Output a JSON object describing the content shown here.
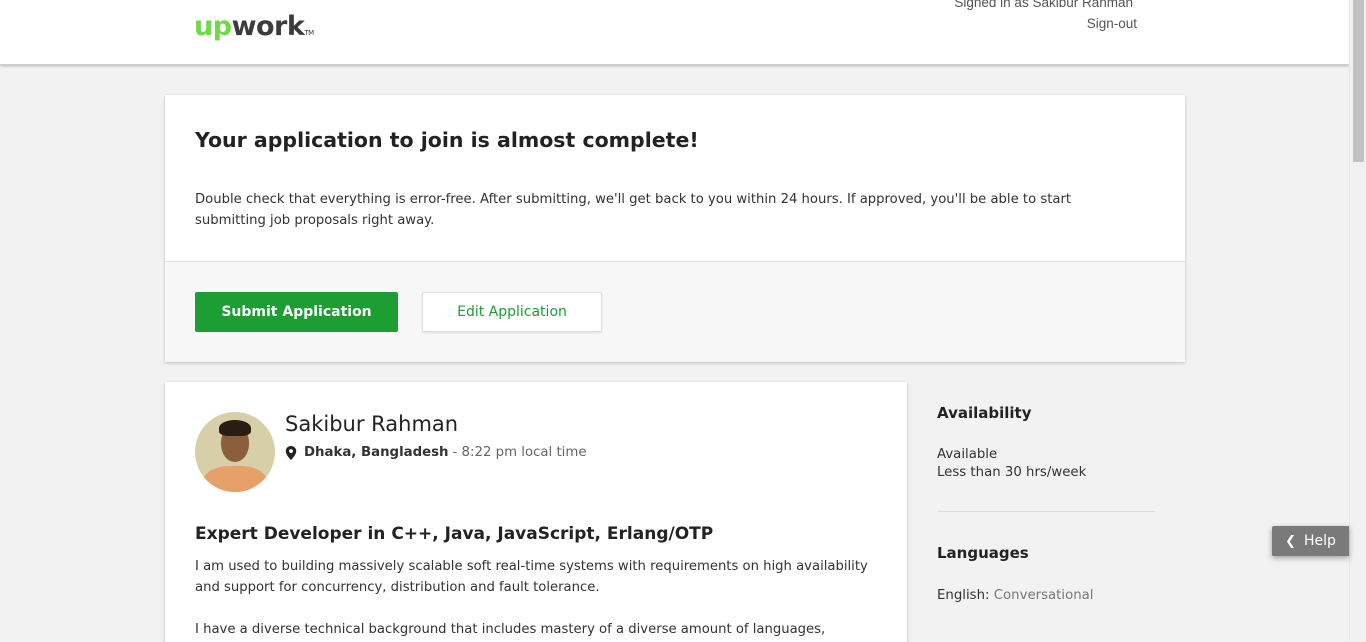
{
  "header": {
    "logo_up": "up",
    "logo_work": "work",
    "logo_tm": "TM",
    "signed_in_text": "Signed in as Sakibur Rahman",
    "signout_label": "Sign-out"
  },
  "application": {
    "title": "Your application to join is almost complete!",
    "description": "Double check that everything is error-free. After submitting, we'll get back to you within 24 hours. If approved, you'll be able to start submitting job proposals right away.",
    "submit_label": "Submit Application",
    "edit_label": "Edit Application"
  },
  "profile": {
    "name": "Sakibur Rahman",
    "location": "Dhaka, Bangladesh",
    "local_time": "- 8:22 pm local time",
    "title": "Expert Developer in C++, Java, JavaScript, Erlang/OTP",
    "bio_p1": "I am used to building massively scalable soft real-time systems with requirements on high availability and support for concurrency, distribution and fault tolerance.",
    "bio_p2": "I have a diverse technical background that includes mastery of a diverse amount of languages,"
  },
  "sidebar": {
    "availability_heading": "Availability",
    "availability_status": "Available",
    "availability_hours": "Less than 30 hrs/week",
    "languages_heading": "Languages",
    "language_name": "English:",
    "language_level": "Conversational"
  },
  "help": {
    "label": "Help"
  },
  "colors": {
    "brand_green": "#6fda44",
    "button_green": "#1d9e33",
    "help_bg": "#7a7a7a"
  },
  "icons": [
    "map-pin-icon",
    "chevron-left-icon"
  ]
}
